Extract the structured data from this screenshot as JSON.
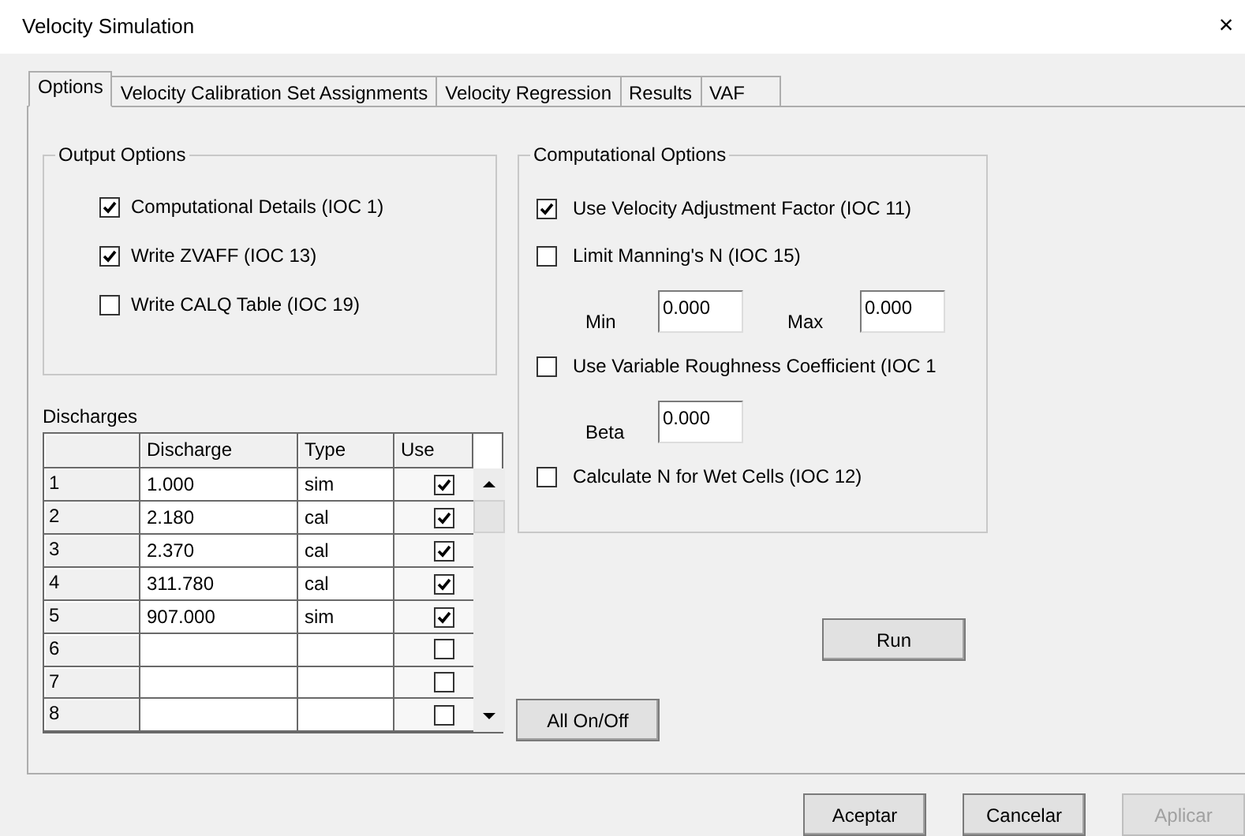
{
  "window": {
    "title": "Velocity Simulation",
    "close": "×"
  },
  "tabs": [
    {
      "label": "Options",
      "selected": true
    },
    {
      "label": "Velocity Calibration Set Assignments",
      "selected": false
    },
    {
      "label": "Velocity Regression",
      "selected": false
    },
    {
      "label": "Results",
      "selected": false
    },
    {
      "label": "VAF",
      "selected": false
    }
  ],
  "output_options": {
    "title": "Output Options",
    "items": [
      {
        "label": "Computational Details (IOC 1)",
        "checked": true
      },
      {
        "label": "Write ZVAFF (IOC 13)",
        "checked": true
      },
      {
        "label": "Write CALQ Table (IOC 19)",
        "checked": false
      }
    ]
  },
  "discharges": {
    "title": "Discharges",
    "columns": [
      "Discharge",
      "Type",
      "Use"
    ],
    "rows": [
      {
        "index": "1",
        "discharge": "1.000",
        "type": "sim",
        "use": true
      },
      {
        "index": "2",
        "discharge": "2.180",
        "type": "cal",
        "use": true
      },
      {
        "index": "3",
        "discharge": "2.370",
        "type": "cal",
        "use": true
      },
      {
        "index": "4",
        "discharge": "311.780",
        "type": "cal",
        "use": true
      },
      {
        "index": "5",
        "discharge": "907.000",
        "type": "sim",
        "use": true
      },
      {
        "index": "6",
        "discharge": "",
        "type": "",
        "use": false
      },
      {
        "index": "7",
        "discharge": "",
        "type": "",
        "use": false
      },
      {
        "index": "8",
        "discharge": "",
        "type": "",
        "use": false
      }
    ]
  },
  "computational_options": {
    "title": "Computational Options",
    "items": [
      {
        "kind": "checkbox",
        "label": "Use Velocity Adjustment Factor (IOC 11)",
        "checked": true
      },
      {
        "kind": "checkbox",
        "label": "Limit Manning's N (IOC 15)",
        "checked": false
      },
      {
        "kind": "fields",
        "fields": [
          {
            "label": "Min",
            "value": "0.000"
          },
          {
            "label": "Max",
            "value": "0.000"
          }
        ]
      },
      {
        "kind": "checkbox",
        "label": "Use Variable Roughness Coefficient (IOC 1",
        "checked": false
      },
      {
        "kind": "fields",
        "fields": [
          {
            "label": "Beta",
            "value": "0.000"
          }
        ]
      },
      {
        "kind": "checkbox",
        "label": "Calculate N for Wet Cells (IOC 12)",
        "checked": false
      }
    ]
  },
  "run_button": "Run",
  "all_toggle_button": "All On/Off",
  "buttons": [
    {
      "label": "Aceptar",
      "disabled": false
    },
    {
      "label": "Cancelar",
      "disabled": false
    },
    {
      "label": "Aplicar",
      "disabled": true
    }
  ]
}
